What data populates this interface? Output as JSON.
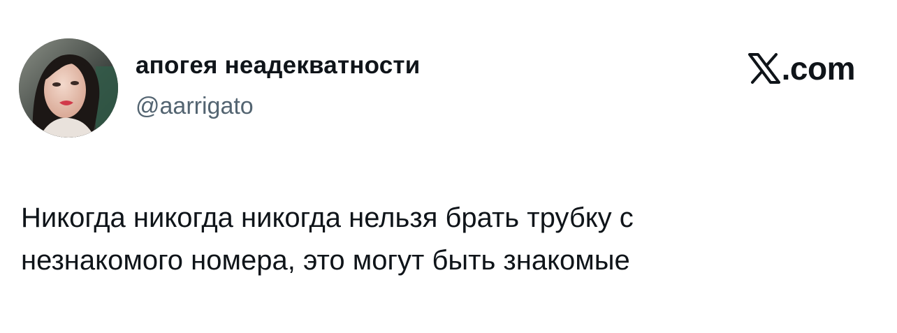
{
  "author": {
    "display_name": "апогея неадекватности",
    "handle": "@aarrigato",
    "avatar_icon": "profile-photo"
  },
  "brand": {
    "logo_icon": "x-logo-icon",
    "domain": ".com"
  },
  "tweet": {
    "lines": [
      "Никогда никогда никогда нельзя брать трубку с",
      "незнакомого номера, это могут быть знакомые"
    ]
  },
  "colors": {
    "text_primary": "#0f1419",
    "text_secondary": "#536471",
    "background": "#ffffff"
  }
}
